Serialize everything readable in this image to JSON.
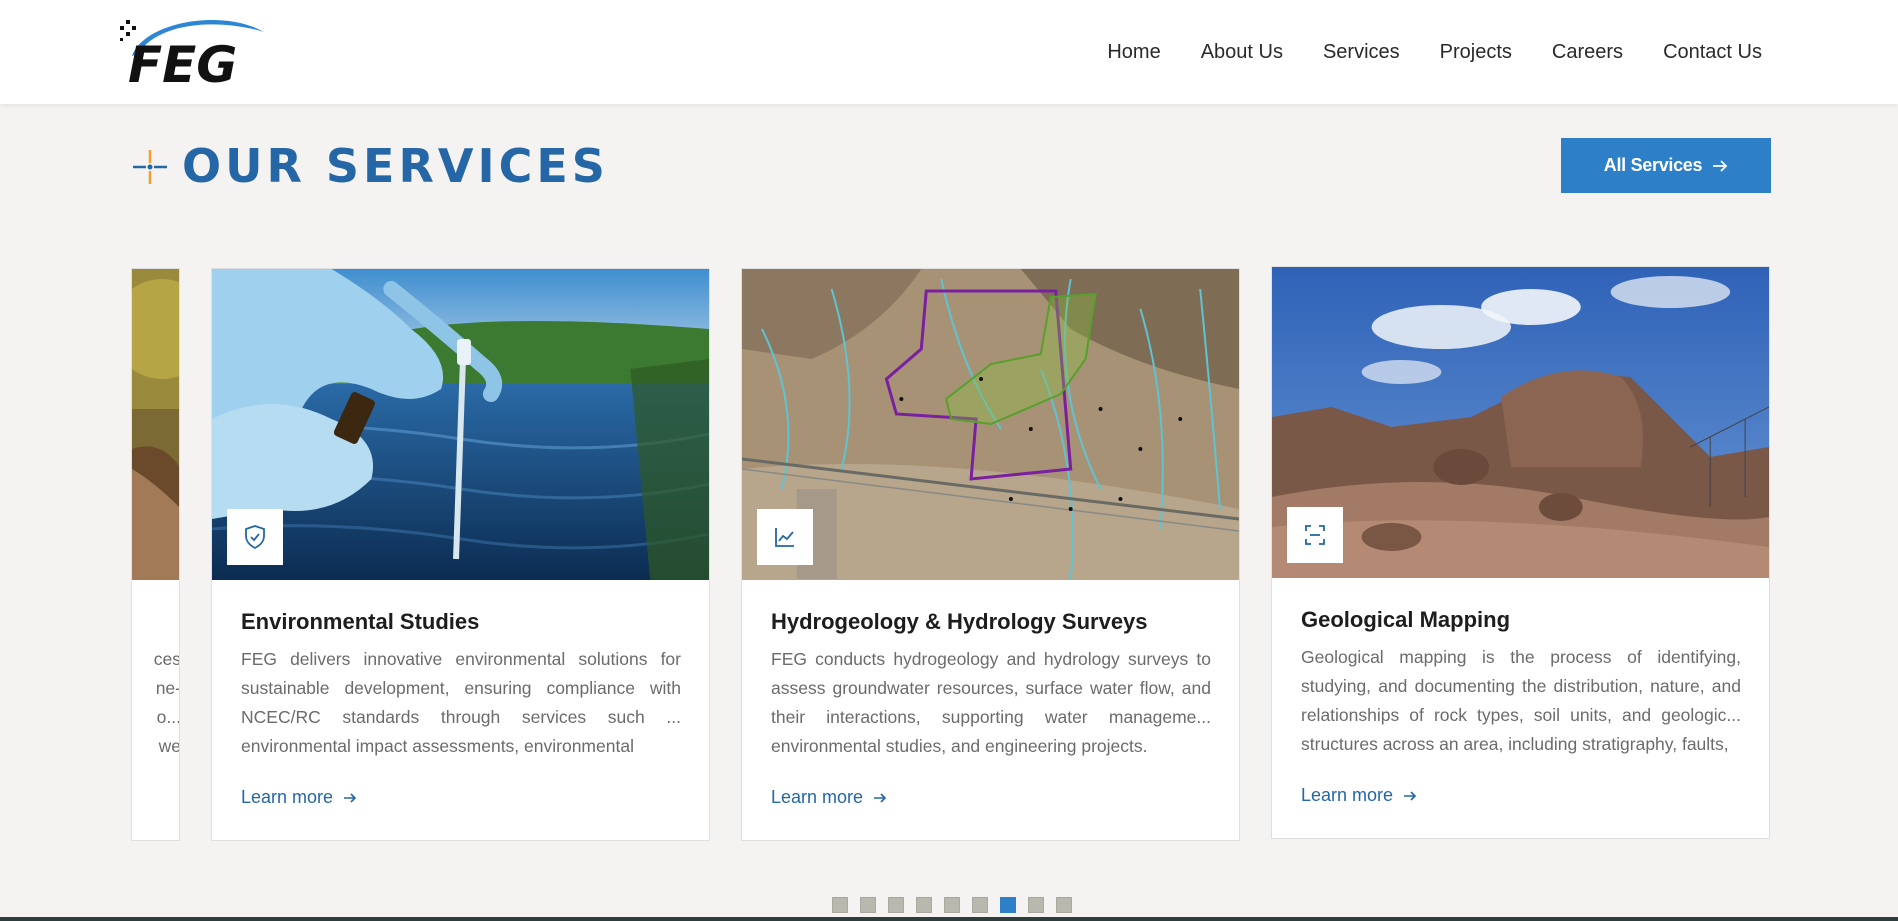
{
  "brand": {
    "logo_text": "FEG"
  },
  "nav": {
    "items": [
      "Home",
      "About Us",
      "Services",
      "Projects",
      "Careers",
      "Contact Us"
    ]
  },
  "section": {
    "title": "OUR SERVICES",
    "all_button": "All Services"
  },
  "partial_card": {
    "text_lines": [
      "ces",
      "ne-",
      "o...",
      "we"
    ]
  },
  "cards": [
    {
      "title": "Environmental Studies",
      "icon": "shield-check-icon",
      "description": "FEG delivers innovative environmental solutions for sustainable development, ensuring compliance with NCEC/RC standards through services such ... environmental impact assessments, environmental",
      "link": "Learn more"
    },
    {
      "title": "Hydrogeology & Hydrology Surveys",
      "icon": "line-chart-icon",
      "description": "FEG conducts hydrogeology and hydrology surveys to assess groundwater resources, surface water flow, and their interactions, supporting water manageme... environmental studies, and engineering projects.",
      "link": "Learn more"
    },
    {
      "title": "Geological Mapping",
      "icon": "scan-icon",
      "description": "Geological mapping is the process of identifying, studying, and documenting the distribution, nature, and relationships of rock types, soil units, and geologic... structures across an area, including stratigraphy, faults,",
      "link": "Learn more"
    }
  ],
  "pagination": {
    "count": 9,
    "active_index": 6
  },
  "colors": {
    "accent": "#2d7fc8",
    "title_blue": "#2466a6",
    "logo_orange": "#f0a030"
  }
}
